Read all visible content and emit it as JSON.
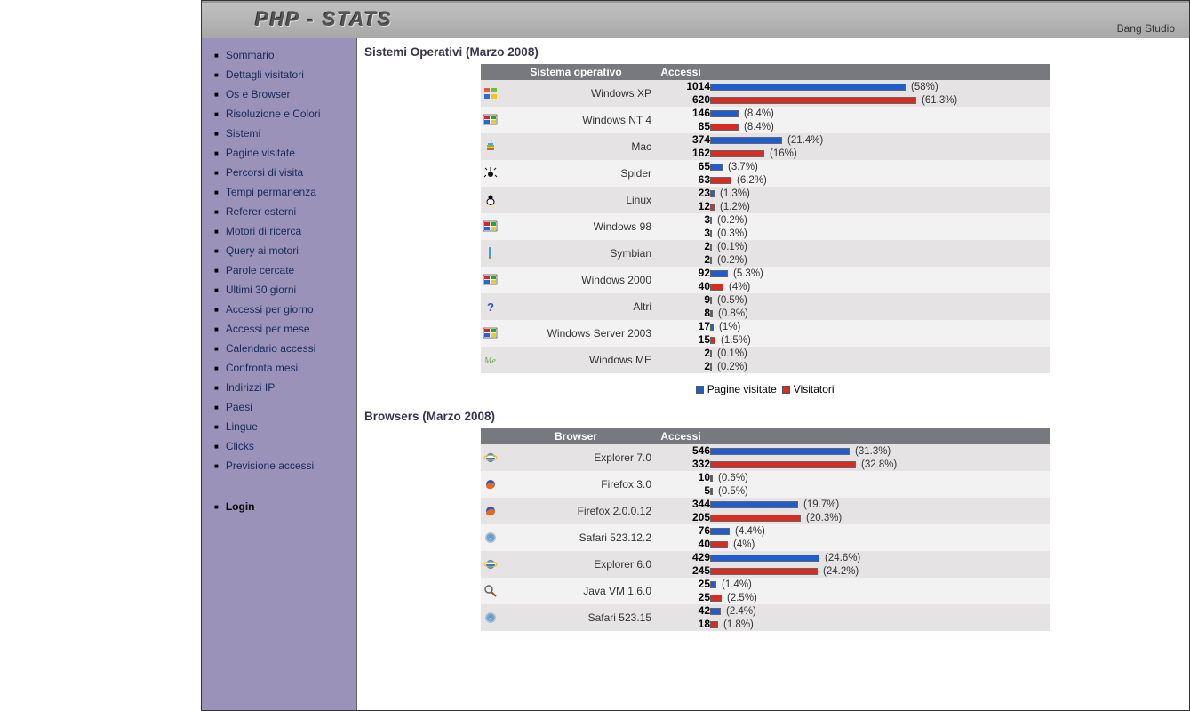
{
  "header": {
    "logo": "PHP - STATS",
    "brand_right": "Bang Studio"
  },
  "sidebar": {
    "items": [
      "Sommario",
      "Dettagli visitatori",
      "Os e Browser",
      "Risoluzione e Colori",
      "Sistemi",
      "Pagine visitate",
      "Percorsi di visita",
      "Tempi permanenza",
      "Referer esterni",
      "Motori di ricerca",
      "Query ai motori",
      "Parole cercate",
      "Ultimi 30 giorni",
      "Accessi per giorno",
      "Accessi per mese",
      "Calendario accessi",
      "Confronta mesi",
      "Indirizzi IP",
      "Paesi",
      "Lingue",
      "Clicks",
      "Previsione accessi"
    ],
    "login": "Login"
  },
  "os_section": {
    "title": "Sistemi Operativi (Marzo 2008)",
    "columns": {
      "name": "Sistema operativo",
      "acc": "Accessi"
    },
    "rows": [
      {
        "icon": "winxp",
        "name": "Windows XP",
        "pv": 1014,
        "pv_pct": "58%",
        "vis": 620,
        "vis_pct": "61.3%",
        "pv_w": 220,
        "vis_w": 232
      },
      {
        "icon": "winnt",
        "name": "Windows NT 4",
        "pv": 146,
        "pv_pct": "8.4%",
        "vis": 85,
        "vis_pct": "8.4%",
        "pv_w": 32,
        "vis_w": 32
      },
      {
        "icon": "mac",
        "name": "Mac",
        "pv": 374,
        "pv_pct": "21.4%",
        "vis": 162,
        "vis_pct": "16%",
        "pv_w": 81,
        "vis_w": 61
      },
      {
        "icon": "spider",
        "name": "Spider",
        "pv": 65,
        "pv_pct": "3.7%",
        "vis": 63,
        "vis_pct": "6.2%",
        "pv_w": 14,
        "vis_w": 24
      },
      {
        "icon": "linux",
        "name": "Linux",
        "pv": 23,
        "pv_pct": "1.3%",
        "vis": 12,
        "vis_pct": "1.2%",
        "pv_w": 5,
        "vis_w": 5
      },
      {
        "icon": "win98",
        "name": "Windows 98",
        "pv": 3,
        "pv_pct": "0.2%",
        "vis": 3,
        "vis_pct": "0.3%",
        "pv_w": 1,
        "vis_w": 1
      },
      {
        "icon": "symbian",
        "name": "Symbian",
        "pv": 2,
        "pv_pct": "0.1%",
        "vis": 2,
        "vis_pct": "0.2%",
        "pv_w": 1,
        "vis_w": 1
      },
      {
        "icon": "win2000",
        "name": "Windows 2000",
        "pv": 92,
        "pv_pct": "5.3%",
        "vis": 40,
        "vis_pct": "4%",
        "pv_w": 20,
        "vis_w": 15
      },
      {
        "icon": "altri",
        "name": "Altri",
        "pv": 9,
        "pv_pct": "0.5%",
        "vis": 8,
        "vis_pct": "0.8%",
        "pv_w": 2,
        "vis_w": 3
      },
      {
        "icon": "winsrv",
        "name": "Windows Server 2003",
        "pv": 17,
        "pv_pct": "1%",
        "vis": 15,
        "vis_pct": "1.5%",
        "pv_w": 4,
        "vis_w": 6
      },
      {
        "icon": "winme",
        "name": "Windows ME",
        "pv": 2,
        "pv_pct": "0.1%",
        "vis": 2,
        "vis_pct": "0.2%",
        "pv_w": 1,
        "vis_w": 1
      }
    ]
  },
  "browser_section": {
    "title": "Browsers (Marzo 2008)",
    "columns": {
      "name": "Browser",
      "acc": "Accessi"
    },
    "rows": [
      {
        "icon": "ie",
        "name": "Explorer 7.0",
        "pv": 546,
        "pv_pct": "31.3%",
        "vis": 332,
        "vis_pct": "32.8%",
        "pv_w": 157,
        "vis_w": 164
      },
      {
        "icon": "ff",
        "name": "Firefox 3.0",
        "pv": 10,
        "pv_pct": "0.6%",
        "vis": 5,
        "vis_pct": "0.5%",
        "pv_w": 3,
        "vis_w": 3
      },
      {
        "icon": "ff",
        "name": "Firefox 2.0.0.12",
        "pv": 344,
        "pv_pct": "19.7%",
        "vis": 205,
        "vis_pct": "20.3%",
        "pv_w": 99,
        "vis_w": 102
      },
      {
        "icon": "safari",
        "name": "Safari 523.12.2",
        "pv": 76,
        "pv_pct": "4.4%",
        "vis": 40,
        "vis_pct": "4%",
        "pv_w": 22,
        "vis_w": 20
      },
      {
        "icon": "ie",
        "name": "Explorer 6.0",
        "pv": 429,
        "pv_pct": "24.6%",
        "vis": 245,
        "vis_pct": "24.2%",
        "pv_w": 123,
        "vis_w": 121
      },
      {
        "icon": "java",
        "name": "Java VM 1.6.0",
        "pv": 25,
        "pv_pct": "1.4%",
        "vis": 25,
        "vis_pct": "2.5%",
        "pv_w": 7,
        "vis_w": 13
      },
      {
        "icon": "safari",
        "name": "Safari 523.15",
        "pv": 42,
        "pv_pct": "2.4%",
        "vis": 18,
        "vis_pct": "1.8%",
        "pv_w": 12,
        "vis_w": 9
      }
    ]
  },
  "legend": {
    "pv": "Pagine visitate",
    "vis": "Visitatori"
  },
  "chart_data": [
    {
      "type": "bar",
      "title": "Sistemi Operativi (Marzo 2008)",
      "categories": [
        "Windows XP",
        "Windows NT 4",
        "Mac",
        "Spider",
        "Linux",
        "Windows 98",
        "Symbian",
        "Windows 2000",
        "Altri",
        "Windows Server 2003",
        "Windows ME"
      ],
      "series": [
        {
          "name": "Pagine visitate",
          "values_abs": [
            1014,
            146,
            374,
            65,
            23,
            3,
            2,
            92,
            9,
            17,
            2
          ],
          "values_pct": [
            58,
            8.4,
            21.4,
            3.7,
            1.3,
            0.2,
            0.1,
            5.3,
            0.5,
            1,
            0.1
          ]
        },
        {
          "name": "Visitatori",
          "values_abs": [
            620,
            85,
            162,
            63,
            12,
            3,
            2,
            40,
            8,
            15,
            2
          ],
          "values_pct": [
            61.3,
            8.4,
            16,
            6.2,
            1.2,
            0.3,
            0.2,
            4,
            0.8,
            1.5,
            0.2
          ]
        }
      ],
      "xlabel": "",
      "ylabel": "%",
      "ylim": [
        0,
        100
      ]
    },
    {
      "type": "bar",
      "title": "Browsers (Marzo 2008)",
      "categories": [
        "Explorer 7.0",
        "Firefox 3.0",
        "Firefox 2.0.0.12",
        "Safari 523.12.2",
        "Explorer 6.0",
        "Java VM 1.6.0",
        "Safari 523.15"
      ],
      "series": [
        {
          "name": "Pagine visitate",
          "values_abs": [
            546,
            10,
            344,
            76,
            429,
            25,
            42
          ],
          "values_pct": [
            31.3,
            0.6,
            19.7,
            4.4,
            24.6,
            1.4,
            2.4
          ]
        },
        {
          "name": "Visitatori",
          "values_abs": [
            332,
            5,
            205,
            40,
            245,
            25,
            18
          ],
          "values_pct": [
            32.8,
            0.5,
            20.3,
            4,
            24.2,
            2.5,
            1.8
          ]
        }
      ],
      "xlabel": "",
      "ylabel": "%",
      "ylim": [
        0,
        100
      ]
    }
  ]
}
